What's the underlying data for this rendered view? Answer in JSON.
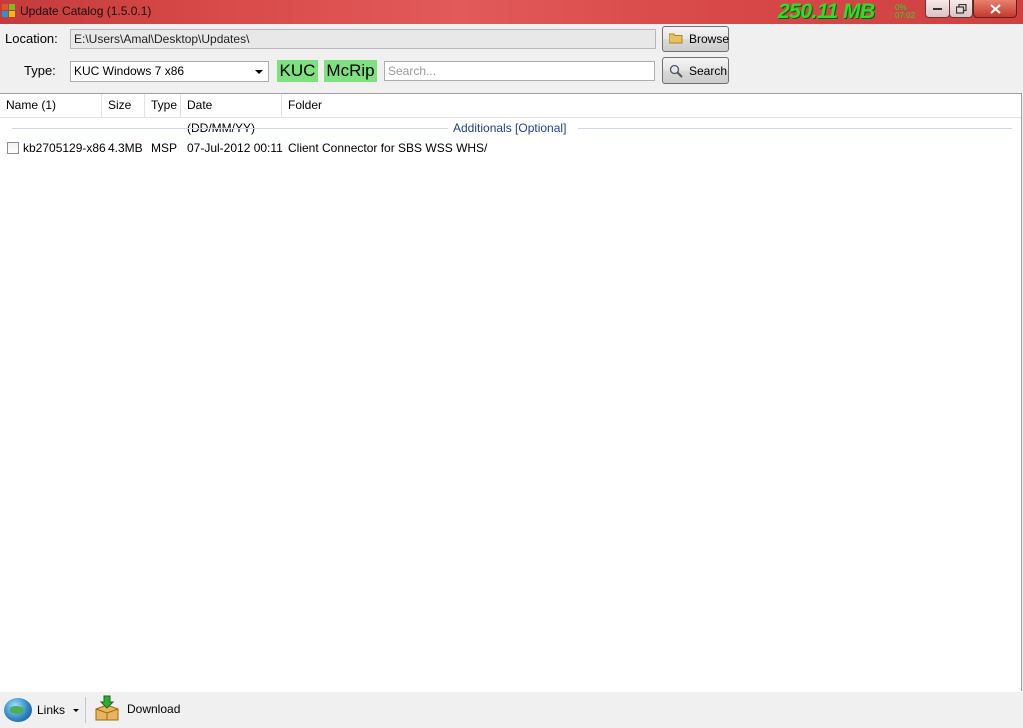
{
  "window": {
    "title": "Update Catalog (1.5.0.1)",
    "overlay_size": "250.11 MB",
    "overlay_small_1": "0%",
    "overlay_small_2": "07:02"
  },
  "location": {
    "label": "Location:",
    "value": "E:\\Users\\Amal\\Desktop\\Updates\\",
    "browse_label": "Browse"
  },
  "type": {
    "label": "Type:",
    "selected": "KUC Windows 7 x86",
    "tag_kuc": "KUC",
    "tag_mcrip": "McRip",
    "search_placeholder": "Search...",
    "search_label": "Search"
  },
  "list": {
    "columns": [
      "Name (1)",
      "Size",
      "Type",
      "Date (DD/MM/YY)",
      "Folder"
    ],
    "group_label": "Additionals [Optional]",
    "rows": [
      {
        "name": "kb2705129-x86",
        "size": "4.3MB",
        "type": "MSP",
        "date": "07-Jul-2012 00:11",
        "folder": "Client Connector for SBS WSS WHS/",
        "checked": false
      }
    ]
  },
  "statusbar": {
    "links_label": "Links",
    "download_label": "Download"
  },
  "colors": {
    "titlebar": "#d94a4a",
    "tag_green": "#7fe07f",
    "group_text": "#1e3f8a",
    "overlay_green": "#29e029"
  }
}
